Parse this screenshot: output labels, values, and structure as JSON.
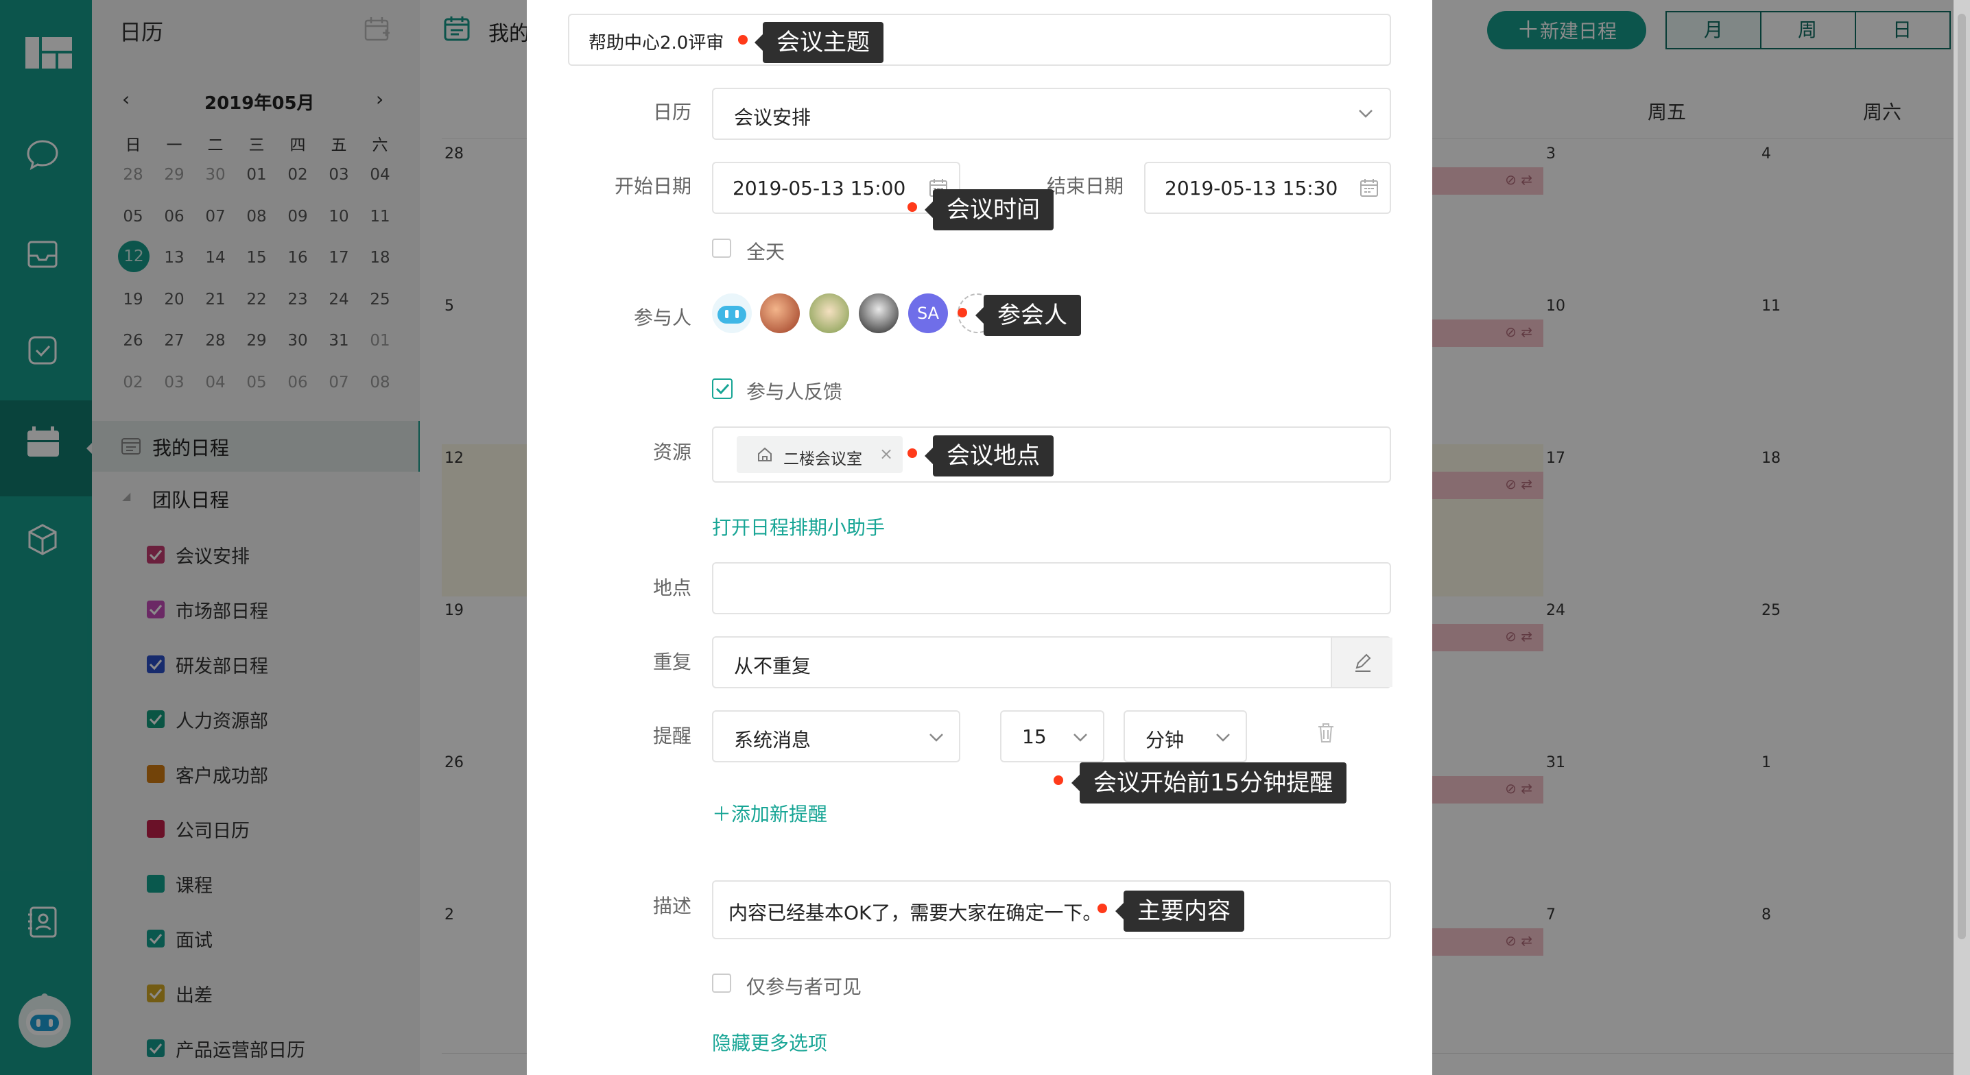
{
  "sidebar": {
    "title": "日历",
    "mini_calendar": {
      "month_label": "2019年05月",
      "weekdays": [
        "日",
        "一",
        "二",
        "三",
        "四",
        "五",
        "六"
      ],
      "weeks": [
        [
          "28",
          "29",
          "30",
          "01",
          "02",
          "03",
          "04"
        ],
        [
          "05",
          "06",
          "07",
          "08",
          "09",
          "10",
          "11"
        ],
        [
          "12",
          "13",
          "14",
          "15",
          "16",
          "17",
          "18"
        ],
        [
          "19",
          "20",
          "21",
          "22",
          "23",
          "24",
          "25"
        ],
        [
          "26",
          "27",
          "28",
          "29",
          "30",
          "31",
          "01"
        ],
        [
          "02",
          "03",
          "04",
          "05",
          "06",
          "07",
          "08"
        ]
      ],
      "today": "12"
    },
    "my_schedule": "我的日程",
    "team_schedule": "团队日程",
    "calendars": [
      {
        "label": "会议安排",
        "color": "#c43b6f",
        "checked": true
      },
      {
        "label": "市场部日程",
        "color": "#c34bb8",
        "checked": true
      },
      {
        "label": "研发部日程",
        "color": "#2b4fc7",
        "checked": true
      },
      {
        "label": "人力资源部",
        "color": "#139b7c",
        "checked": true
      },
      {
        "label": "客户成功部",
        "color": "#cf7a12",
        "checked": false
      },
      {
        "label": "公司日历",
        "color": "#c2204a",
        "checked": false
      },
      {
        "label": "课程",
        "color": "#12a08d",
        "checked": false
      },
      {
        "label": "面试",
        "color": "#13a08f",
        "checked": true
      },
      {
        "label": "出差",
        "color": "#d1a826",
        "checked": true
      },
      {
        "label": "产品运营部日历",
        "color": "#159c8e",
        "checked": true
      }
    ]
  },
  "header": {
    "title_partial": "我的",
    "new_event_button": "新建日程",
    "views": [
      "月",
      "周",
      "日"
    ],
    "active_view": "月"
  },
  "calendar_grid": {
    "visible_weekdays": [
      "周五",
      "周六"
    ],
    "rows": [
      {
        "left": "28",
        "fri": "3",
        "sat": "4"
      },
      {
        "left": "5",
        "fri": "10",
        "sat": "11"
      },
      {
        "left": "12",
        "fri": "17",
        "sat": "18"
      },
      {
        "left": "19",
        "fri": "24",
        "sat": "25"
      },
      {
        "left": "26",
        "fri": "31",
        "sat": "1"
      },
      {
        "left": "2",
        "fri": "7",
        "sat": "8"
      }
    ]
  },
  "form": {
    "subject_value": "帮助中心2.0评审",
    "calendar_label": "日历",
    "calendar_value": "会议安排",
    "start_label": "开始日期",
    "start_value": "2019-05-13 15:00",
    "end_label": "结束日期",
    "end_value": "2019-05-13 15:30",
    "all_day_label": "全天",
    "attendees_label": "参与人",
    "attendee_initials": "SA",
    "feedback_label": "参与人反馈",
    "resource_label": "资源",
    "resource_tag": "二楼会议室",
    "scheduler_link": "打开日程排期小助手",
    "location_label": "地点",
    "location_value": "",
    "repeat_label": "重复",
    "repeat_value": "从不重复",
    "reminder_label": "提醒",
    "reminder_type": "系统消息",
    "reminder_amount": "15",
    "reminder_unit": "分钟",
    "add_reminder_link": "添加新提醒",
    "description_label": "描述",
    "description_value": "内容已经基本OK了，需要大家在确定一下。",
    "private_label": "仅参与者可见",
    "hide_more_link": "隐藏更多选项"
  },
  "annotations": {
    "subject": "会议主题",
    "time": "会议时间",
    "attendees": "参会人",
    "location": "会议地点",
    "reminder": "会议开始前15分钟提醒",
    "content": "主要内容"
  },
  "colors": {
    "brand": "#179b8b",
    "link": "#17a595",
    "annotation_dot": "#ff3a1a"
  }
}
